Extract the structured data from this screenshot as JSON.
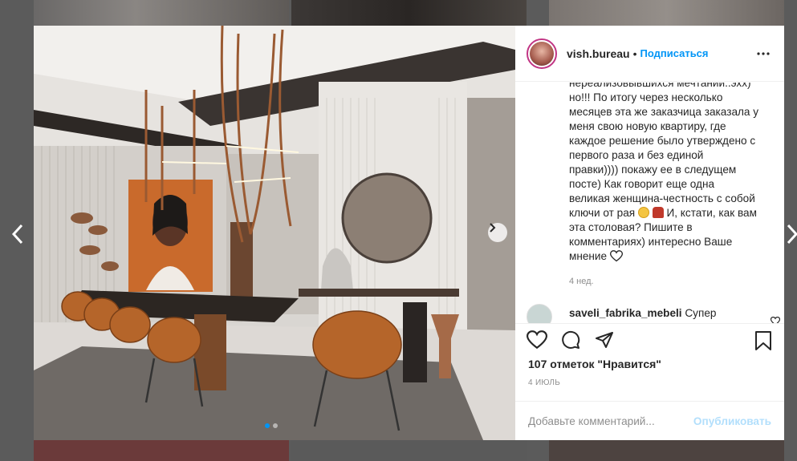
{
  "post": {
    "username": "vish.bureau",
    "separator": "•",
    "follow_label": "Подписаться",
    "caption_lines": [
      "нереализовывшихся мечтаний..эхх)",
      "но!!! По итогу через несколько",
      "месяцев эта же заказчица заказала у",
      "меня свою новую квартиру, где",
      "каждое решение было утверждено с",
      "первого раза и без единой",
      "правки)))) покажу ее в следущем",
      "посте) Как говорит еще одна",
      "великая женщина-честность с собой",
      "ключи от рая",
      "И, кстати, как вам",
      "эта столовая? Пишите в",
      "комментариях) интересно Ваше",
      "мнение"
    ],
    "caption_time": "4 нед.",
    "comment": {
      "username": "saveli_fabrika_mebeli",
      "text": "Супер"
    },
    "likes": "107 отметок \"Нравится\"",
    "date": "4 ИЮЛЬ",
    "add_comment_placeholder": "Добавьте комментарий...",
    "publish_label": "Опубликовать"
  },
  "carousel": {
    "dot_count": 2,
    "active_index": 0
  },
  "colors": {
    "accent": "#0095f6",
    "publish_disabled": "#b2dffc",
    "text": "#262626",
    "muted": "#8e8e8e"
  },
  "icons": {
    "like": "heart-icon",
    "comment": "comment-bubble-icon",
    "share": "paper-plane-icon",
    "save": "bookmark-icon",
    "more": "more-options-icon",
    "prev": "chevron-left-icon",
    "next": "chevron-right-icon"
  }
}
